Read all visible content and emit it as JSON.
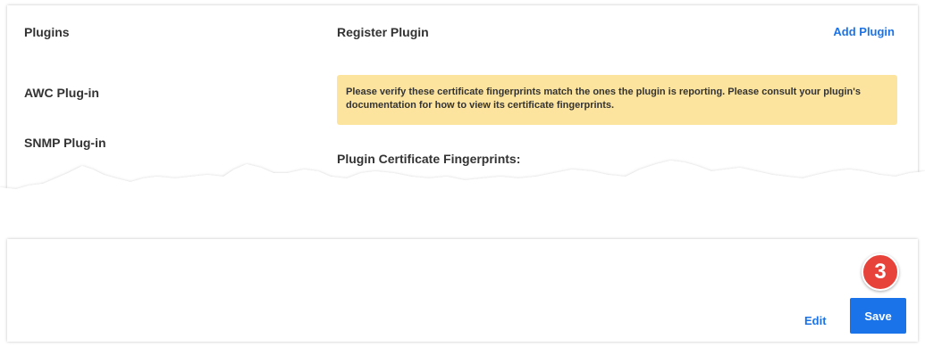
{
  "plugins_panel": {
    "heading": "Plugins",
    "items": [
      {
        "label": "AWC Plug-in"
      },
      {
        "label": "SNMP Plug-in"
      }
    ]
  },
  "register_panel": {
    "heading": "Register Plugin",
    "add_plugin_label": "Add Plugin",
    "warning_text": "Please verify these certificate fingerprints match the ones the plugin is reporting. Please consult your plugin's documentation for how to view its certificate fingerprints.",
    "fingerprints_label": "Plugin Certificate Fingerprints:"
  },
  "actions": {
    "edit_label": "Edit",
    "save_label": "Save"
  },
  "callout": {
    "step_number": "3"
  },
  "colors": {
    "accent": "#1a73e8",
    "warning_bg": "#fde49e",
    "callout": "#e8433a"
  }
}
